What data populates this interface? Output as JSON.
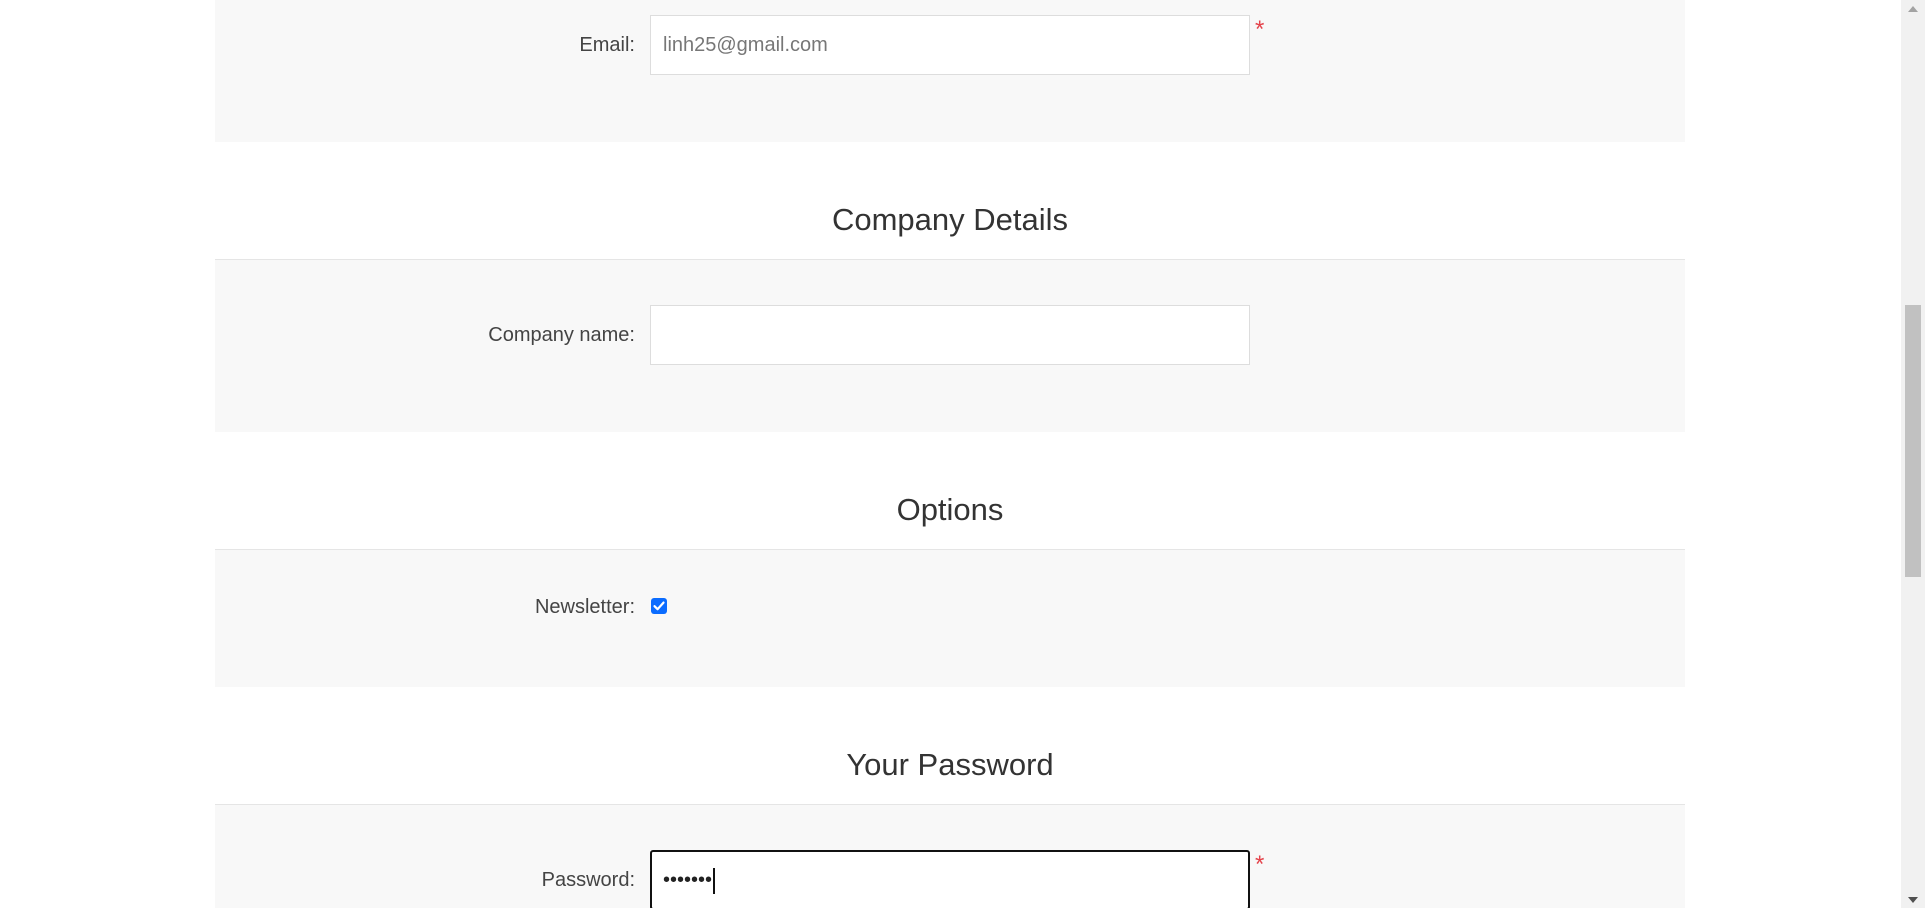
{
  "account": {
    "email_label": "Email:",
    "email_value": "linh25@gmail.com",
    "email_required": "*"
  },
  "company": {
    "title": "Company Details",
    "name_label": "Company name:",
    "name_value": ""
  },
  "options": {
    "title": "Options",
    "newsletter_label": "Newsletter:",
    "newsletter_checked": true
  },
  "password_section": {
    "title": "Your Password",
    "password_label": "Password:",
    "password_masked": "•••••••",
    "password_required": "*"
  },
  "colors": {
    "section_bg": "#f8f8f8",
    "required": "#e4434b",
    "checkbox": "#0b6cff"
  },
  "icons": {
    "checkbox": "checkmark-icon",
    "scroll_up": "triangle-up-icon",
    "scroll_down": "triangle-down-icon"
  }
}
